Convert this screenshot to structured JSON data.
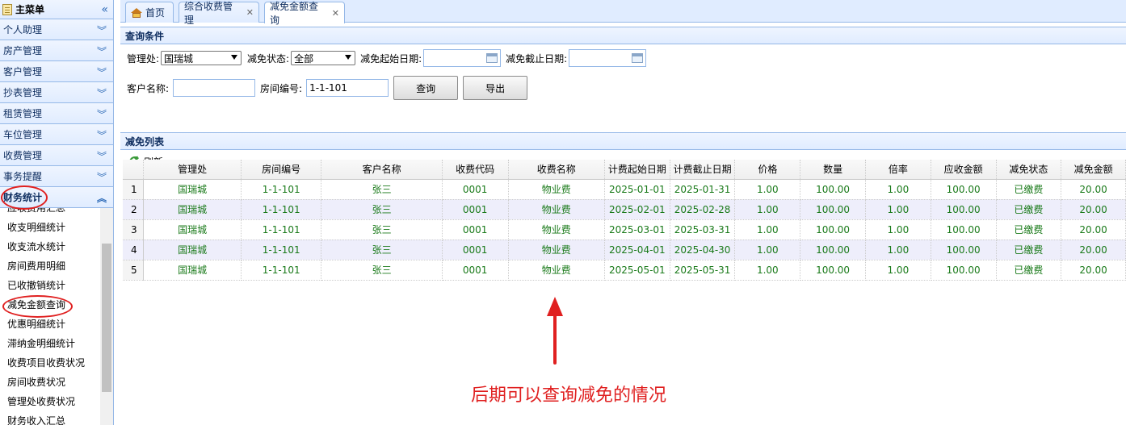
{
  "sidebar": {
    "title": "主菜单",
    "collapse_glyph": "«",
    "groups": [
      {
        "label": "个人助理"
      },
      {
        "label": "房产管理"
      },
      {
        "label": "客户管理"
      },
      {
        "label": "抄表管理"
      },
      {
        "label": "租赁管理"
      },
      {
        "label": "车位管理"
      },
      {
        "label": "收费管理"
      },
      {
        "label": "事务提醒"
      },
      {
        "label": "财务统计"
      }
    ],
    "sub_items": [
      {
        "label": "应收费用汇总"
      },
      {
        "label": "收支明细统计"
      },
      {
        "label": "收支流水统计"
      },
      {
        "label": "房间费用明细"
      },
      {
        "label": "已收撤销统计"
      },
      {
        "label": "减免金额查询"
      },
      {
        "label": "优惠明细统计"
      },
      {
        "label": "滞纳金明细统计"
      },
      {
        "label": "收费项目收费状况"
      },
      {
        "label": "房间收费状况"
      },
      {
        "label": "管理处收费状况"
      },
      {
        "label": "财务收入汇总"
      }
    ]
  },
  "tabs": [
    {
      "label": "首页"
    },
    {
      "label": "综合收费管理"
    },
    {
      "label": "减免金额查询"
    }
  ],
  "query": {
    "title": "查询条件",
    "office_label": "管理处:",
    "office_value": "国瑞城",
    "status_label": "减免状态:",
    "status_value": "全部",
    "start_label": "减免起始日期:",
    "start_value": "",
    "end_label": "减免截止日期:",
    "end_value": "",
    "customer_label": "客户名称:",
    "customer_value": "",
    "room_label": "房间编号:",
    "room_value": "1-1-101",
    "search_btn": "查询",
    "export_btn": "导出"
  },
  "list": {
    "title": "减免列表",
    "refresh_label": "刷新",
    "columns": [
      "管理处",
      "房间编号",
      "客户名称",
      "收费代码",
      "收费名称",
      "计费起始日期",
      "计费截止日期",
      "价格",
      "数量",
      "倍率",
      "应收金额",
      "减免状态",
      "减免金额"
    ],
    "rows": [
      {
        "n": "1",
        "cells": [
          "国瑞城",
          "1-1-101",
          "张三",
          "0001",
          "物业费",
          "2025-01-01",
          "2025-01-31",
          "1.00",
          "100.00",
          "1.00",
          "100.00",
          "已缴费",
          "20.00"
        ]
      },
      {
        "n": "2",
        "cells": [
          "国瑞城",
          "1-1-101",
          "张三",
          "0001",
          "物业费",
          "2025-02-01",
          "2025-02-28",
          "1.00",
          "100.00",
          "1.00",
          "100.00",
          "已缴费",
          "20.00"
        ]
      },
      {
        "n": "3",
        "cells": [
          "国瑞城",
          "1-1-101",
          "张三",
          "0001",
          "物业费",
          "2025-03-01",
          "2025-03-31",
          "1.00",
          "100.00",
          "1.00",
          "100.00",
          "已缴费",
          "20.00"
        ]
      },
      {
        "n": "4",
        "cells": [
          "国瑞城",
          "1-1-101",
          "张三",
          "0001",
          "物业费",
          "2025-04-01",
          "2025-04-30",
          "1.00",
          "100.00",
          "1.00",
          "100.00",
          "已缴费",
          "20.00"
        ]
      },
      {
        "n": "5",
        "cells": [
          "国瑞城",
          "1-1-101",
          "张三",
          "0001",
          "物业费",
          "2025-05-01",
          "2025-05-31",
          "1.00",
          "100.00",
          "1.00",
          "100.00",
          "已缴费",
          "20.00"
        ]
      }
    ]
  },
  "annotation": {
    "text": "后期可以查询减免的情况",
    "color": "#e02020"
  },
  "colors": {
    "accent": "#95b8e7",
    "cell_text": "#1a7a1a",
    "alt_row": "#eeeefb"
  }
}
